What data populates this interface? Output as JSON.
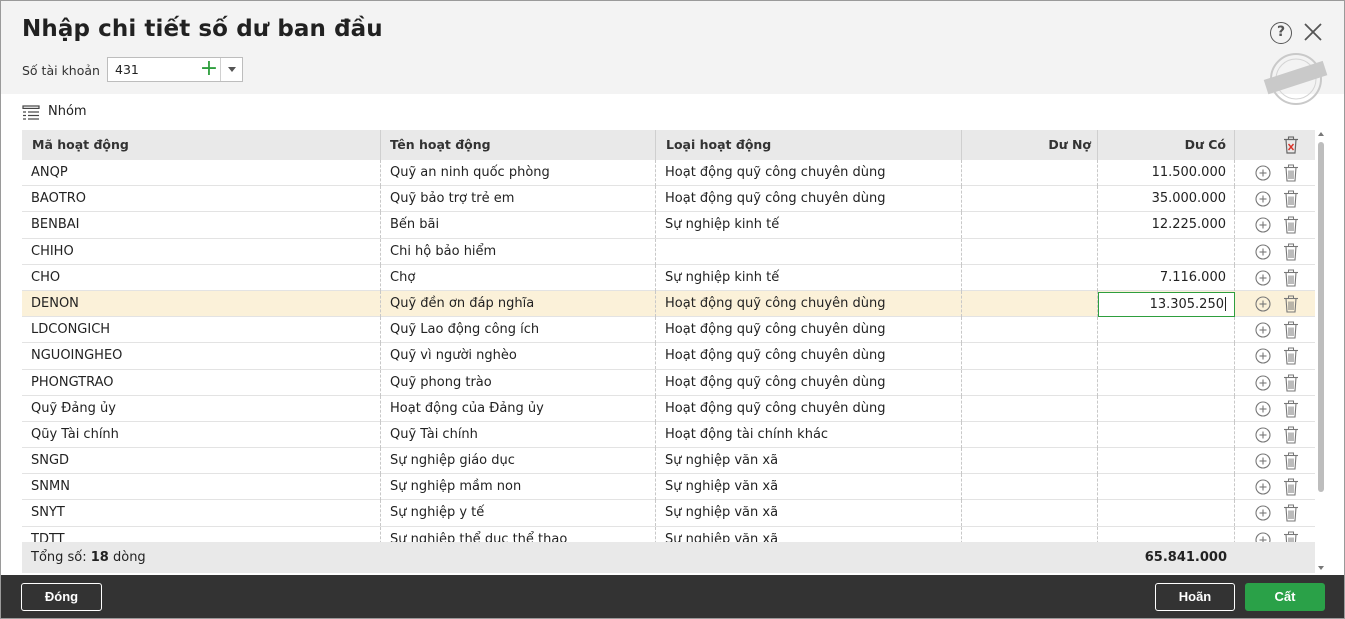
{
  "dialog": {
    "title": "Nhập chi tiết số dư ban đầu",
    "account_label": "Số tài khoản",
    "account_value": "431",
    "stamp_text": "DỮ LIỆU MẪU"
  },
  "toolbar": {
    "group_label": "Nhóm"
  },
  "grid": {
    "columns": [
      "Mã hoạt động",
      "Tên hoạt động",
      "Loại hoạt động",
      "Dư Nợ",
      "Dư Có"
    ],
    "rows": [
      {
        "code": "ANQP",
        "name": "Quỹ an ninh quốc phòng",
        "type": "Hoạt động quỹ công chuyên dùng",
        "debit": "",
        "credit": "11.500.000"
      },
      {
        "code": "BAOTRO",
        "name": "Quỹ bảo trợ trẻ em",
        "type": "Hoạt động quỹ công chuyên dùng",
        "debit": "",
        "credit": "35.000.000"
      },
      {
        "code": "BENBAI",
        "name": "Bến bãi",
        "type": "Sự nghiệp kinh tế",
        "debit": "",
        "credit": "12.225.000"
      },
      {
        "code": "CHIHO",
        "name": "Chi hộ bảo hiểm",
        "type": "",
        "debit": "",
        "credit": ""
      },
      {
        "code": "CHO",
        "name": "Chợ",
        "type": "Sự nghiệp kinh tế",
        "debit": "",
        "credit": "7.116.000"
      },
      {
        "code": "DENON",
        "name": "Quỹ đền ơn đáp nghĩa",
        "type": "Hoạt động quỹ công chuyên dùng",
        "debit": "",
        "credit": "13.305.250"
      },
      {
        "code": "LDCONGICH",
        "name": "Quỹ Lao động công ích",
        "type": "Hoạt động quỹ công chuyên dùng",
        "debit": "",
        "credit": ""
      },
      {
        "code": "NGUOINGHEO",
        "name": "Quỹ vì người nghèo",
        "type": "Hoạt động quỹ công chuyên dùng",
        "debit": "",
        "credit": ""
      },
      {
        "code": "PHONGTRAO",
        "name": "Quỹ phong trào",
        "type": "Hoạt động quỹ công chuyên dùng",
        "debit": "",
        "credit": ""
      },
      {
        "code": "Quỹ Đảng ủy",
        "name": "Hoạt động của Đảng ủy",
        "type": "Hoạt động quỹ công chuyên dùng",
        "debit": "",
        "credit": ""
      },
      {
        "code": "Qũy Tài chính",
        "name": "Quỹ Tài chính",
        "type": "Hoạt động tài chính khác",
        "debit": "",
        "credit": ""
      },
      {
        "code": "SNGD",
        "name": "Sự nghiệp giáo dục",
        "type": "Sự nghiệp văn xã",
        "debit": "",
        "credit": ""
      },
      {
        "code": "SNMN",
        "name": "Sự nghiệp mầm non",
        "type": "Sự nghiệp văn xã",
        "debit": "",
        "credit": ""
      },
      {
        "code": "SNYT",
        "name": "Sự nghiệp y tế",
        "type": "Sự nghiệp văn xã",
        "debit": "",
        "credit": ""
      },
      {
        "code": "TDTT",
        "name": "Sự nghiệp thể dục thể thao",
        "type": "Sự nghiệp văn xã",
        "debit": "",
        "credit": ""
      }
    ],
    "selected_row": 5,
    "footer": {
      "label_prefix": "Tổng số: ",
      "count": "18",
      "label_suffix": " dòng",
      "total_credit": "65.841.000"
    }
  },
  "buttons": {
    "close": "Đóng",
    "cancel": "Hoãn",
    "save": "Cất"
  },
  "colors": {
    "accent": "#2aa148",
    "selected_row": "#fbf1d9",
    "footer_bar": "#333333"
  }
}
